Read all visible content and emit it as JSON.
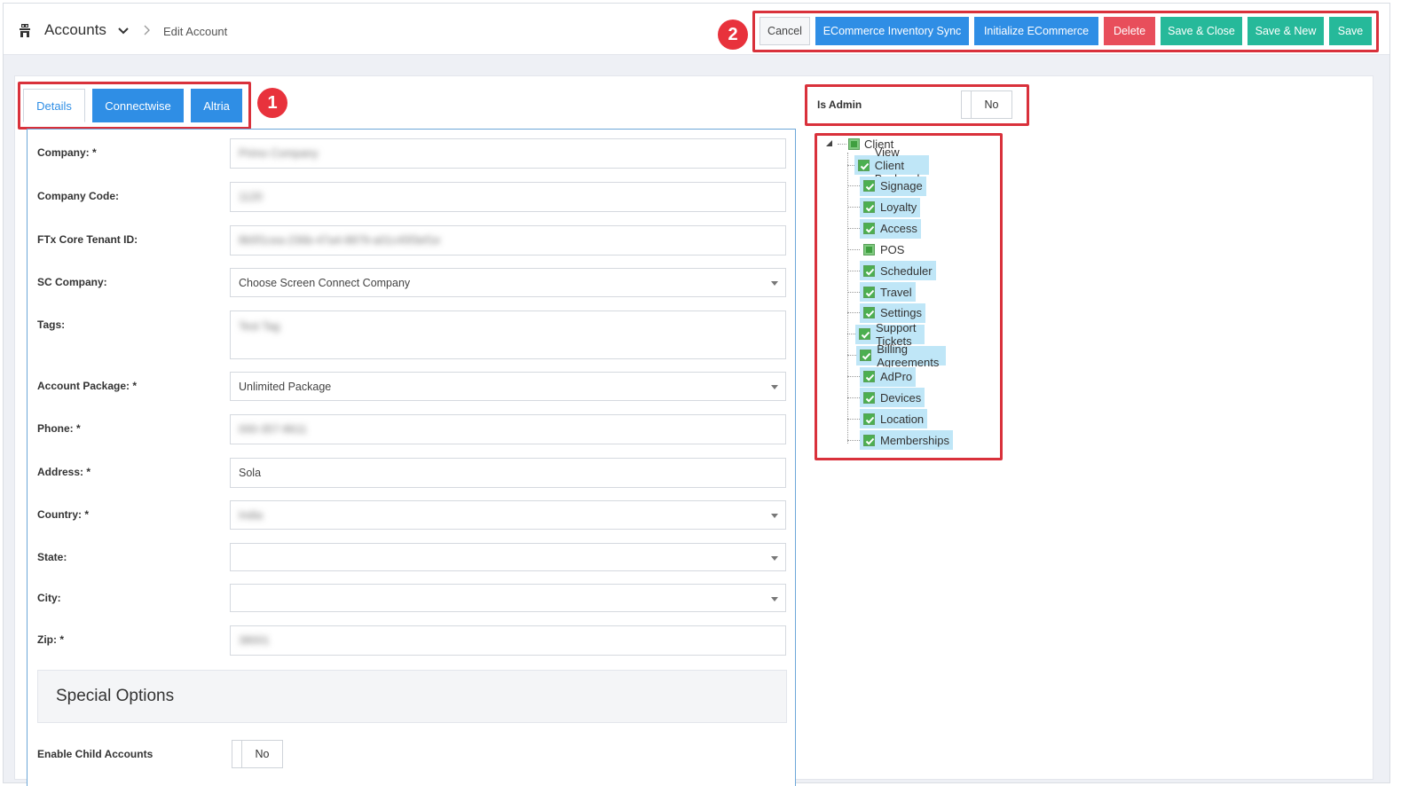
{
  "header": {
    "module_title": "Accounts",
    "breadcrumb": "Edit Account"
  },
  "actions": {
    "cancel": "Cancel",
    "ecommerce_sync": "ECommerce Inventory Sync",
    "initialize_ecommerce": "Initialize ECommerce",
    "delete": "Delete",
    "save_close": "Save & Close",
    "save_new": "Save & New",
    "save": "Save"
  },
  "annotations": {
    "one": "1",
    "two": "2"
  },
  "colors": {
    "primary": "#2f8ee5",
    "danger": "#e84e5b",
    "success": "#26b99a",
    "annotation": "#d9313b"
  },
  "tabs": [
    {
      "label": "Details",
      "active": true
    },
    {
      "label": "Connectwise",
      "active": false
    },
    {
      "label": "Altria",
      "active": false
    }
  ],
  "form": {
    "company": {
      "label": "Company: *",
      "value": "Primo Company"
    },
    "company_code": {
      "label": "Company Code:",
      "value": "1120"
    },
    "tenant_id": {
      "label": "FTx Core Tenant ID:",
      "value": "8b5f1cea-236b-47a4-8879-a01c45f3ef1e"
    },
    "sc_company": {
      "label": "SC Company:",
      "value": "Choose Screen Connect Company"
    },
    "tags": {
      "label": "Tags:",
      "value": "Test Tag"
    },
    "account_package": {
      "label": "Account Package: *",
      "value": "Unlimited Package"
    },
    "phone": {
      "label": "Phone: *",
      "value": "000-357-8611"
    },
    "address": {
      "label": "Address: *",
      "value": "Sola"
    },
    "country": {
      "label": "Country: *",
      "value": "India"
    },
    "state": {
      "label": "State:",
      "value": ""
    },
    "city": {
      "label": "City:",
      "value": ""
    },
    "zip": {
      "label": "Zip: *",
      "value": "38001"
    },
    "special_options": "Special Options",
    "enable_child": {
      "label": "Enable Child Accounts",
      "value": "No"
    }
  },
  "admin": {
    "label": "Is Admin",
    "value": "No"
  },
  "tree": {
    "root": "Client",
    "items": [
      {
        "label": "View Client Backend",
        "checked": true
      },
      {
        "label": "Signage",
        "checked": true
      },
      {
        "label": "Loyalty",
        "checked": true
      },
      {
        "label": "Access",
        "checked": true
      },
      {
        "label": "POS",
        "checked": false
      },
      {
        "label": "Scheduler",
        "checked": true
      },
      {
        "label": "Travel",
        "checked": true
      },
      {
        "label": "Settings",
        "checked": true
      },
      {
        "label": "Support Tickets",
        "checked": true
      },
      {
        "label": "Billing Agreements",
        "checked": true
      },
      {
        "label": "AdPro",
        "checked": true
      },
      {
        "label": "Devices",
        "checked": true
      },
      {
        "label": "Location",
        "checked": true
      },
      {
        "label": "Memberships",
        "checked": true
      }
    ]
  }
}
